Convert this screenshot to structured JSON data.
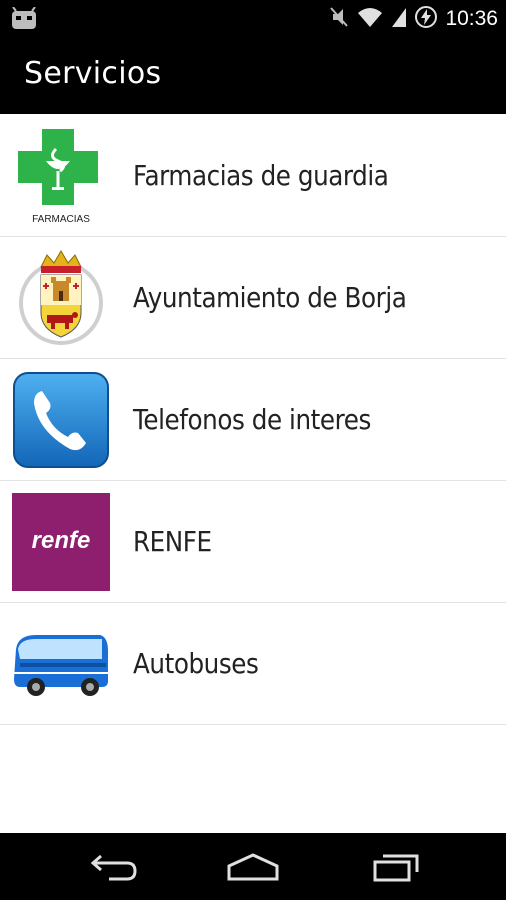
{
  "status_bar": {
    "time": "10:36",
    "icons": [
      "android-icon",
      "mute-icon",
      "wifi-icon",
      "signal-icon",
      "battery-charging-icon"
    ]
  },
  "action_bar": {
    "title": "Servicios"
  },
  "list": {
    "items": [
      {
        "label": "Farmacias de guardia",
        "icon": "pharmacy-cross-icon",
        "icon_caption": "FARMACIAS"
      },
      {
        "label": "Ayuntamiento de Borja",
        "icon": "coat-of-arms-icon"
      },
      {
        "label": "Telefonos de interes",
        "icon": "phone-icon"
      },
      {
        "label": "RENFE",
        "icon": "renfe-logo-icon",
        "icon_caption": "renfe"
      },
      {
        "label": "Autobuses",
        "icon": "bus-icon"
      }
    ]
  },
  "nav_bar": {
    "buttons": [
      "back-icon",
      "home-icon",
      "recent-apps-icon"
    ]
  },
  "colors": {
    "bar_background": "#000000",
    "pharmacy_green": "#2db34a",
    "renfe_purple": "#8e1e6e",
    "phone_blue": "#1e88d6"
  }
}
